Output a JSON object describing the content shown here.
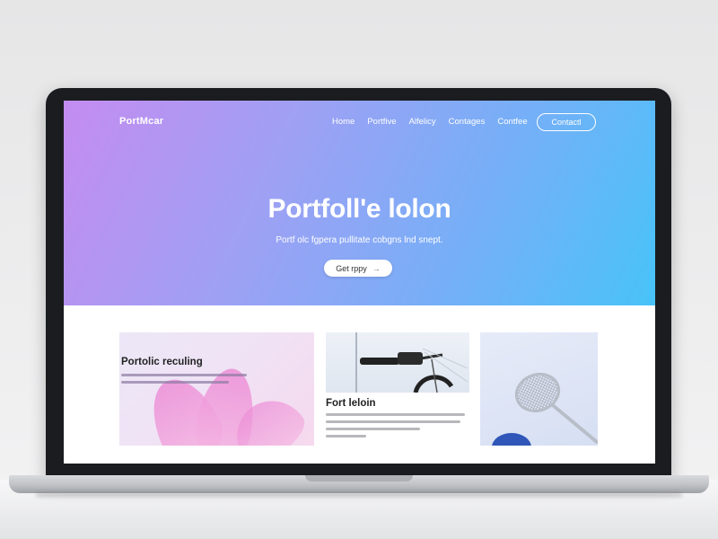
{
  "site": {
    "logo": "PortMcar",
    "nav": [
      "Home",
      "Portfive",
      "Alfelicy",
      "Contages",
      "Contfee"
    ],
    "nav_cta": "Contactl"
  },
  "hero": {
    "title": "Portfoll'e lolon",
    "subtitle": "Portf olc fgpera pullitate cobgns lnd snept.",
    "button": "Get rppy",
    "button_icon": "arrow-right-icon"
  },
  "cards": [
    {
      "title": "Portolic reculing"
    },
    {
      "title": "Fort leloin"
    },
    {
      "title": ""
    }
  ],
  "colors": {
    "hero_gradient_start": "#c48cf0",
    "hero_gradient_end": "#48c3f8",
    "bezel": "#1b1c20"
  }
}
